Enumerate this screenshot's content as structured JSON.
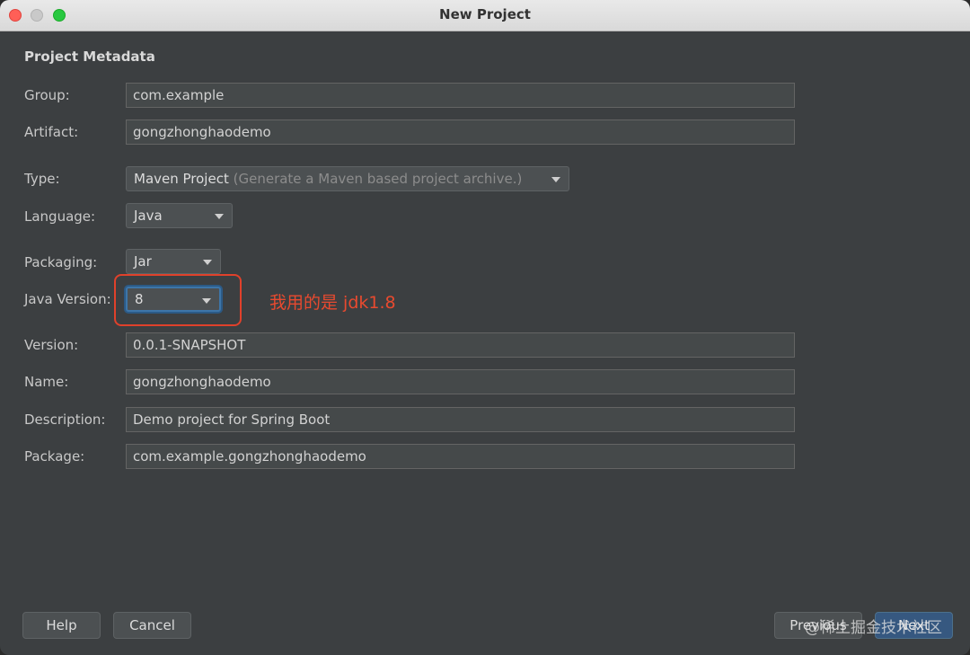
{
  "window": {
    "title": "New Project"
  },
  "section_title": "Project Metadata",
  "fields": {
    "group": {
      "label": "Group:",
      "value": "com.example"
    },
    "artifact": {
      "label": "Artifact:",
      "value": "gongzhonghaodemo"
    },
    "type": {
      "label": "Type:",
      "value": "Maven Project",
      "hint": "(Generate a Maven based project archive.)"
    },
    "language": {
      "label": "Language:",
      "value": "Java"
    },
    "packaging": {
      "label": "Packaging:",
      "value": "Jar"
    },
    "java_version": {
      "label": "Java Version:",
      "value": "8"
    },
    "version": {
      "label": "Version:",
      "value": "0.0.1-SNAPSHOT"
    },
    "name": {
      "label": "Name:",
      "value": "gongzhonghaodemo"
    },
    "description": {
      "label": "Description:",
      "value": "Demo project for Spring Boot"
    },
    "package": {
      "label": "Package:",
      "value": "com.example.gongzhonghaodemo"
    }
  },
  "annotation": "我用的是 jdk1.8",
  "buttons": {
    "help": "Help",
    "cancel": "Cancel",
    "previous": "Previous",
    "next": "Next"
  },
  "watermark": "@稀土掘金技术社区",
  "colors": {
    "accent": "#365880",
    "annotation": "#e84a2f",
    "close": "#ff5f57",
    "maximize": "#28c840"
  }
}
